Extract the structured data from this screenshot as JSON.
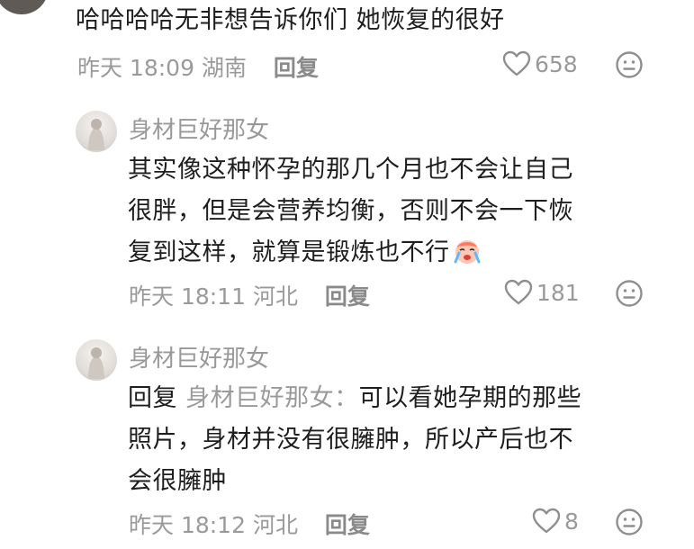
{
  "top_comment": {
    "text": "哈哈哈哈无非想告诉你们 她恢复的很好",
    "time": "昨天 18:09",
    "location": "湖南",
    "reply_label": "回复",
    "likes": "658"
  },
  "replies": [
    {
      "username": "身材巨好那女",
      "lines": [
        "其实像这种怀孕的那几个月也不会让自己",
        "很胖，但是会营养均衡，否则不会一下恢",
        "复到这样，就算是锻炼也不行"
      ],
      "time": "昨天 18:11",
      "location": "河北",
      "reply_label": "回复",
      "likes": "181"
    },
    {
      "username": "身材巨好那女",
      "reply_prefix": "回复",
      "reply_target": "身材巨好那女：",
      "lines": [
        "可以看她孕期的那些",
        "照片，身材并没有很臃肿，所以产后也不",
        "会很臃肿"
      ],
      "time": "昨天 18:12",
      "location": "河北",
      "reply_label": "回复",
      "likes": "8"
    }
  ]
}
